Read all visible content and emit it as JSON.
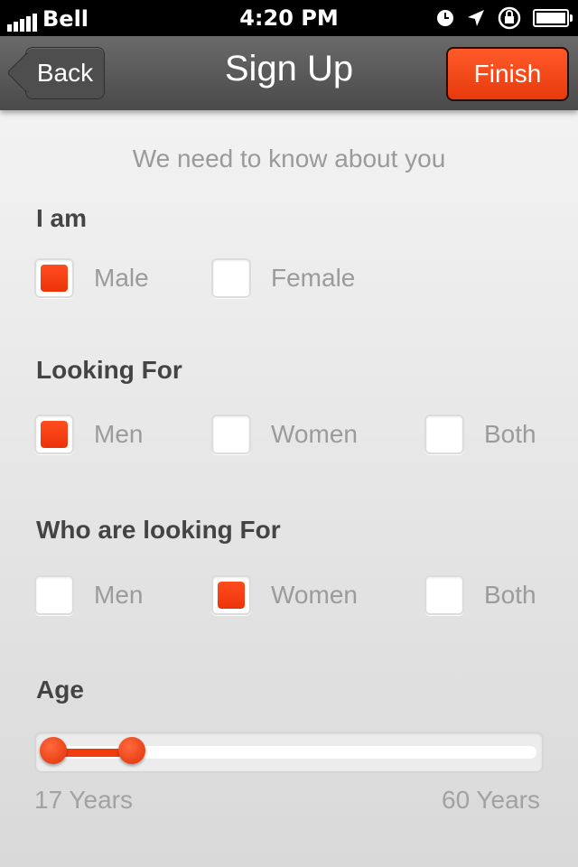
{
  "status_bar": {
    "carrier": "Bell",
    "time": "4:20 PM"
  },
  "nav": {
    "back_label": "Back",
    "title": "Sign Up",
    "finish_label": "Finish"
  },
  "subtitle": "We need to know about you",
  "sections": {
    "i_am": {
      "title": "I am",
      "options": [
        {
          "label": "Male",
          "checked": true
        },
        {
          "label": "Female",
          "checked": false
        }
      ]
    },
    "looking_for": {
      "title": "Looking For",
      "options": [
        {
          "label": "Men",
          "checked": true
        },
        {
          "label": "Women",
          "checked": false
        },
        {
          "label": "Both",
          "checked": false
        }
      ]
    },
    "who_looking_for": {
      "title": "Who are looking For",
      "options": [
        {
          "label": "Men",
          "checked": false
        },
        {
          "label": "Women",
          "checked": true
        },
        {
          "label": "Both",
          "checked": false
        }
      ]
    },
    "age": {
      "title": "Age",
      "min_label": "17 Years",
      "max_label": "60 Years",
      "min": 17,
      "max": 60,
      "selected_low": 17,
      "selected_high": 24
    }
  },
  "colors": {
    "accent": "#f23c0e",
    "nav": "#555555",
    "label_gray": "#9b9b9b"
  }
}
